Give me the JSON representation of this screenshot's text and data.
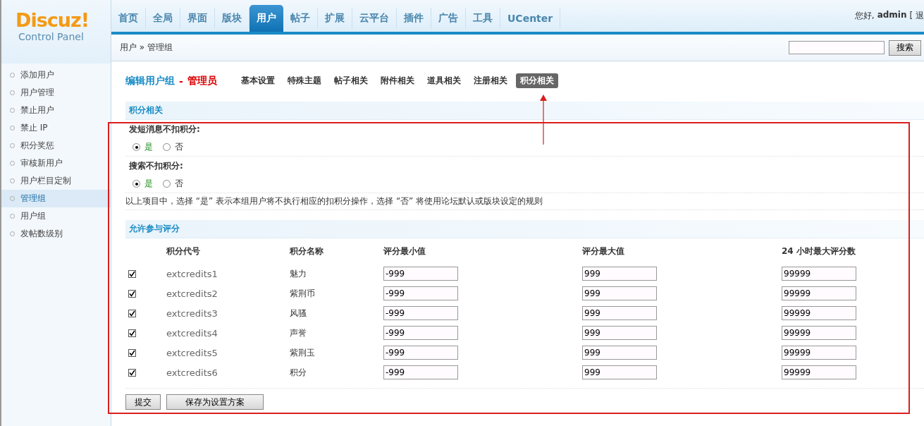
{
  "header": {
    "brand": "Discuz!",
    "subtitle": "Control Panel",
    "greeting": "您好,",
    "user": "admin",
    "logout": "[ 退"
  },
  "nav": [
    {
      "label": "首页",
      "selected": false
    },
    {
      "label": "全局",
      "selected": false
    },
    {
      "label": "界面",
      "selected": false
    },
    {
      "label": "版块",
      "selected": false
    },
    {
      "label": "用户",
      "selected": true
    },
    {
      "label": "帖子",
      "selected": false
    },
    {
      "label": "扩展",
      "selected": false
    },
    {
      "label": "云平台",
      "selected": false
    },
    {
      "label": "插件",
      "selected": false
    },
    {
      "label": "广告",
      "selected": false
    },
    {
      "label": "工具",
      "selected": false
    },
    {
      "label": "UCenter",
      "selected": false
    }
  ],
  "breadcrumb": {
    "parent": "用户",
    "separator": "»",
    "current": "管理组",
    "search_button": "搜索"
  },
  "sidebar": {
    "items": [
      {
        "label": "添加用户",
        "selected": false
      },
      {
        "label": "用户管理",
        "selected": false
      },
      {
        "label": "禁止用户",
        "selected": false
      },
      {
        "label": "禁止 IP",
        "selected": false
      },
      {
        "label": "积分奖惩",
        "selected": false
      },
      {
        "label": "审核新用户",
        "selected": false
      },
      {
        "label": "用户栏目定制",
        "selected": false
      },
      {
        "label": "管理组",
        "selected": true
      },
      {
        "label": "用户组",
        "selected": false
      },
      {
        "label": "发帖数级别",
        "selected": false
      }
    ]
  },
  "page": {
    "title": "编辑用户组",
    "dash": "-",
    "group": "管理员",
    "subtabs": [
      {
        "label": "基本设置",
        "selected": false
      },
      {
        "label": "特殊主题",
        "selected": false
      },
      {
        "label": "帖子相关",
        "selected": false
      },
      {
        "label": "附件相关",
        "selected": false
      },
      {
        "label": "道具相关",
        "selected": false
      },
      {
        "label": "注册相关",
        "selected": false
      },
      {
        "label": "积分相关",
        "selected": true
      }
    ]
  },
  "credit_section": {
    "title": "积分相关",
    "settings": [
      {
        "label": "发短消息不扣积分:",
        "options": [
          {
            "label": "是",
            "selected": true
          },
          {
            "label": "否",
            "selected": false
          }
        ]
      },
      {
        "label": "搜索不扣积分:",
        "options": [
          {
            "label": "是",
            "selected": true
          },
          {
            "label": "否",
            "selected": false
          }
        ]
      }
    ],
    "note": "以上项目中，选择 “是” 表示本组用户将不执行相应的扣积分操作，选择 “否” 将使用论坛默认或版块设定的规则"
  },
  "rating_section": {
    "title": "允许参与评分",
    "columns": [
      "积分代号",
      "积分名称",
      "评分最小值",
      "评分最大值",
      "24 小时最大评分数"
    ],
    "rows": [
      {
        "checked": true,
        "code": "extcredits1",
        "name": "魅力",
        "min": "-999",
        "max": "999",
        "daily": "99999"
      },
      {
        "checked": true,
        "code": "extcredits2",
        "name": "紫荆币",
        "min": "-999",
        "max": "999",
        "daily": "99999"
      },
      {
        "checked": true,
        "code": "extcredits3",
        "name": "风骚",
        "min": "-999",
        "max": "999",
        "daily": "99999"
      },
      {
        "checked": true,
        "code": "extcredits4",
        "name": "声誉",
        "min": "-999",
        "max": "999",
        "daily": "99999"
      },
      {
        "checked": true,
        "code": "extcredits5",
        "name": "紫荆玉",
        "min": "-999",
        "max": "999",
        "daily": "99999"
      },
      {
        "checked": true,
        "code": "extcredits6",
        "name": "积分",
        "min": "-999",
        "max": "999",
        "daily": "99999"
      }
    ]
  },
  "buttons": [
    "提交",
    "保存为设置方案"
  ]
}
